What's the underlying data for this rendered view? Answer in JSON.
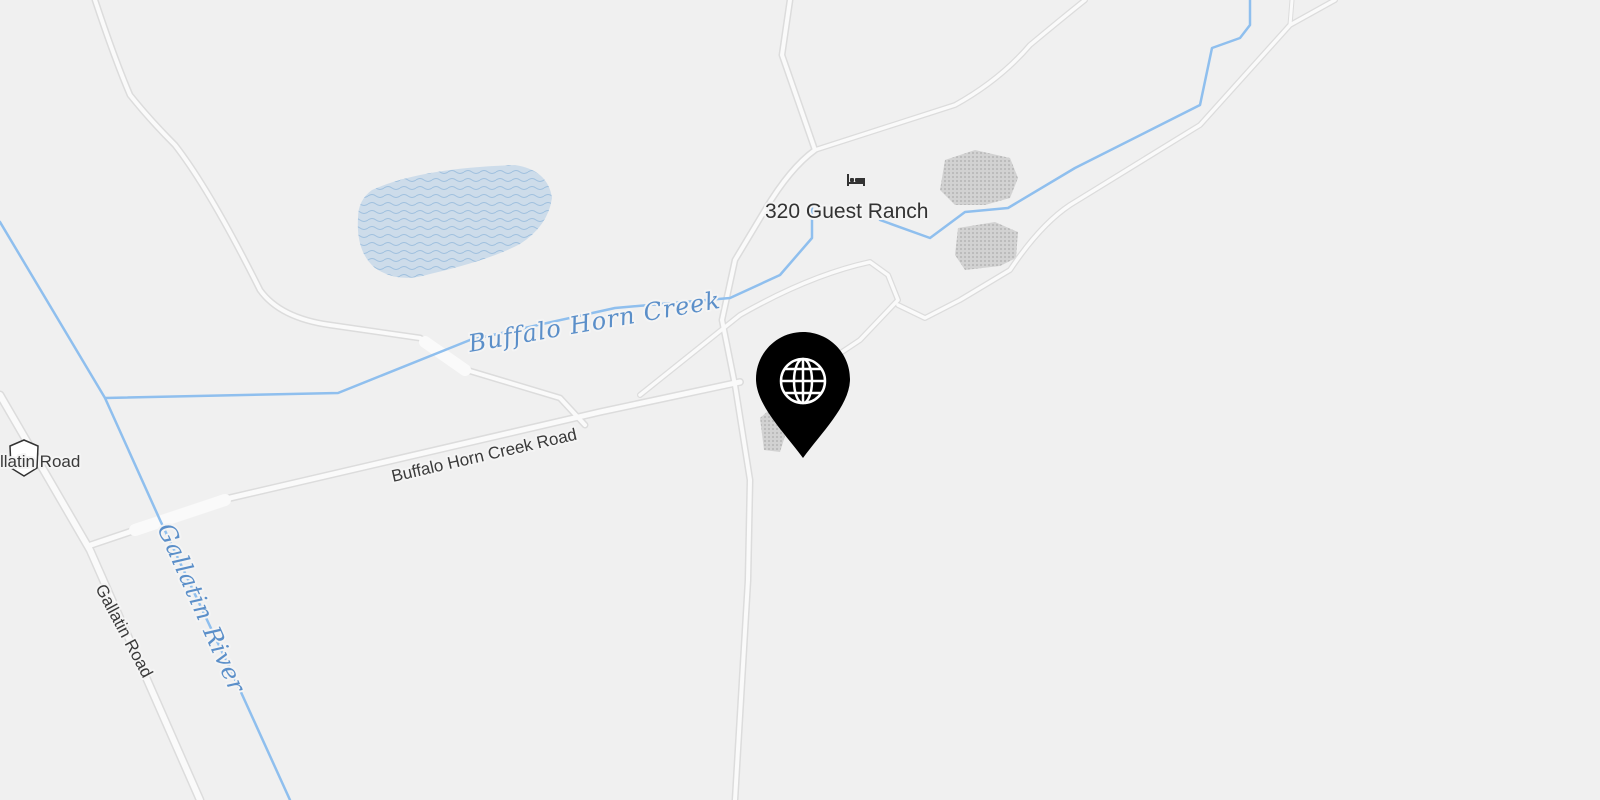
{
  "map": {
    "colors": {
      "land": "#f0f0f0",
      "road": "#fafafa",
      "road_casing": "#dcdcdc",
      "water_line": "#8fbfee",
      "water_fill": "#cddcea",
      "water_label": "#5b8fc9",
      "building": "#c9c9c9",
      "pin": "#000000"
    },
    "road_labels": {
      "buffalo_horn_creek_road": "Buffalo Horn Creek Road",
      "gallatin_road": "Gallatin Road",
      "gallatin_road_shield": "llatin Road"
    },
    "water_labels": {
      "buffalo_horn_creek": "Buffalo Horn Creek",
      "gallatin_river": "Gallatin River"
    },
    "poi": {
      "name": "320 Guest Ranch",
      "icon": "bed-icon"
    },
    "marker": {
      "icon": "globe-icon"
    }
  }
}
